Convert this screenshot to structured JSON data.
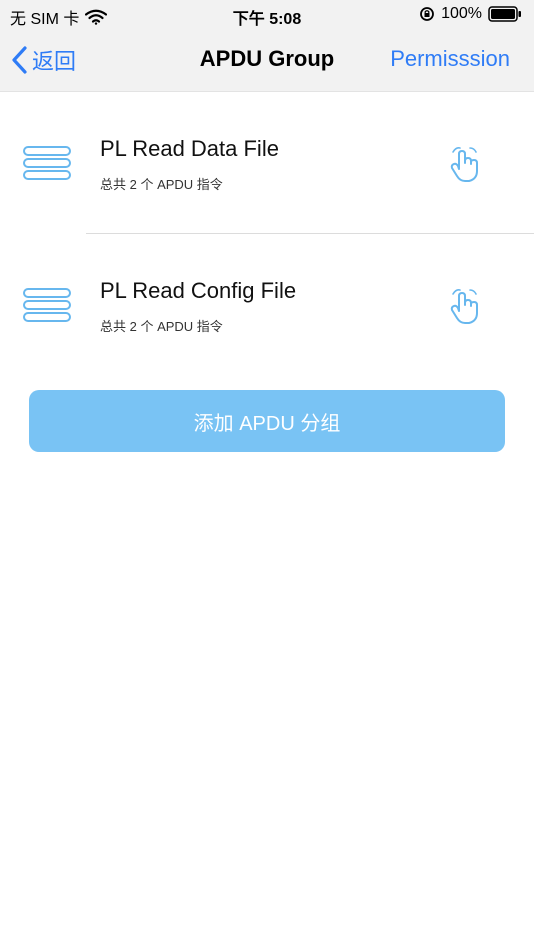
{
  "status_bar": {
    "carrier": "无 SIM 卡",
    "time": "下午 5:08",
    "battery": "100%"
  },
  "nav": {
    "back_label": "返回",
    "title": "APDU Group",
    "right_label": "Permisssion"
  },
  "groups": [
    {
      "title": "PL Read Data File",
      "subtitle": "总共 2 个 APDU 指令"
    },
    {
      "title": "PL Read Config File",
      "subtitle": "总共 2 个 APDU 指令"
    }
  ],
  "add_button_label": "添加 APDU 分组",
  "colors": {
    "accent": "#2f7cf6",
    "button_bg": "#79c3f4",
    "icon": "#67b7ee"
  },
  "icons": {
    "row_icon": "stack-icon",
    "action_icon": "tap-hand-icon",
    "back_icon": "chevron-left-icon",
    "wifi_icon": "wifi-icon",
    "lock_icon": "rotation-lock-icon",
    "battery_icon": "battery-icon"
  }
}
